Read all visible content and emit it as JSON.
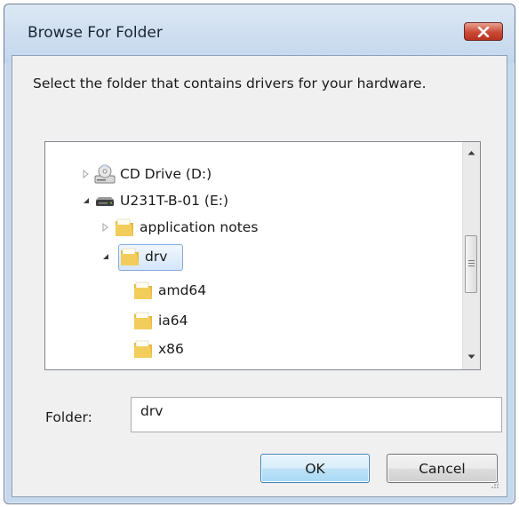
{
  "dialog": {
    "title": "Browse For Folder",
    "instructions": "Select the folder that contains drivers for your hardware.",
    "close_icon": "close-icon"
  },
  "tree": {
    "items": [
      {
        "label": "CD Drive (D:)",
        "icon": "cd-drive-icon",
        "expander": "collapsed",
        "level": 1
      },
      {
        "label": "U231T-B-01 (E:)",
        "icon": "drive-icon",
        "expander": "expanded",
        "level": 1
      },
      {
        "label": "application notes",
        "icon": "folder-icon",
        "expander": "collapsed",
        "level": 2
      },
      {
        "label": "drv",
        "icon": "folder-icon",
        "expander": "expanded",
        "level": 2,
        "selected": true
      },
      {
        "label": "amd64",
        "icon": "folder-icon",
        "expander": "none",
        "level": 3
      },
      {
        "label": "ia64",
        "icon": "folder-icon",
        "expander": "none",
        "level": 3
      },
      {
        "label": "x86",
        "icon": "folder-icon",
        "expander": "none",
        "level": 3
      }
    ]
  },
  "folder": {
    "label": "Folder:",
    "value": "drv"
  },
  "buttons": {
    "ok": "OK",
    "cancel": "Cancel"
  },
  "colors": {
    "frame": "#c6d8ec",
    "close_button": "#c94a36",
    "selection_border": "#84acdd",
    "folder_yellow": "#e7b93c"
  }
}
